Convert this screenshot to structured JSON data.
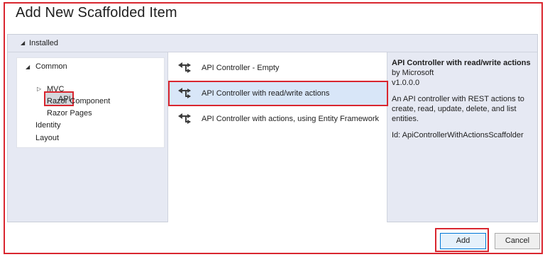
{
  "window": {
    "title": "Add New Scaffolded Item"
  },
  "installed_header": {
    "label": "Installed"
  },
  "tree": {
    "items": [
      {
        "label": "Common",
        "level": 0,
        "expanded": true
      },
      {
        "label": "API",
        "level": 1,
        "selected": true
      },
      {
        "label": "MVC",
        "level": 1,
        "collapsed": true
      },
      {
        "label": "Razor Component",
        "level": 1
      },
      {
        "label": "Razor Pages",
        "level": 1
      },
      {
        "label": "Identity",
        "level": 0
      },
      {
        "label": "Layout",
        "level": 0
      }
    ]
  },
  "templates": [
    {
      "label": "API Controller - Empty",
      "icon": "api-controller-icon"
    },
    {
      "label": "API Controller with read/write actions",
      "icon": "api-controller-icon",
      "selected": true
    },
    {
      "label": "API Controller with actions, using Entity Framework",
      "icon": "api-controller-icon"
    }
  ],
  "details": {
    "title": "API Controller with read/write actions",
    "author": "by Microsoft",
    "version": "v1.0.0.0",
    "description": "An API controller with REST actions to create, read, update, delete, and list entities.",
    "id": "Id: ApiControllerWithActionsScaffolder"
  },
  "buttons": {
    "add": "Add",
    "cancel": "Cancel"
  },
  "colors": {
    "highlight": "#d9262f",
    "selected_row": "#d8e6f8",
    "panel": "#e6e9f3"
  }
}
